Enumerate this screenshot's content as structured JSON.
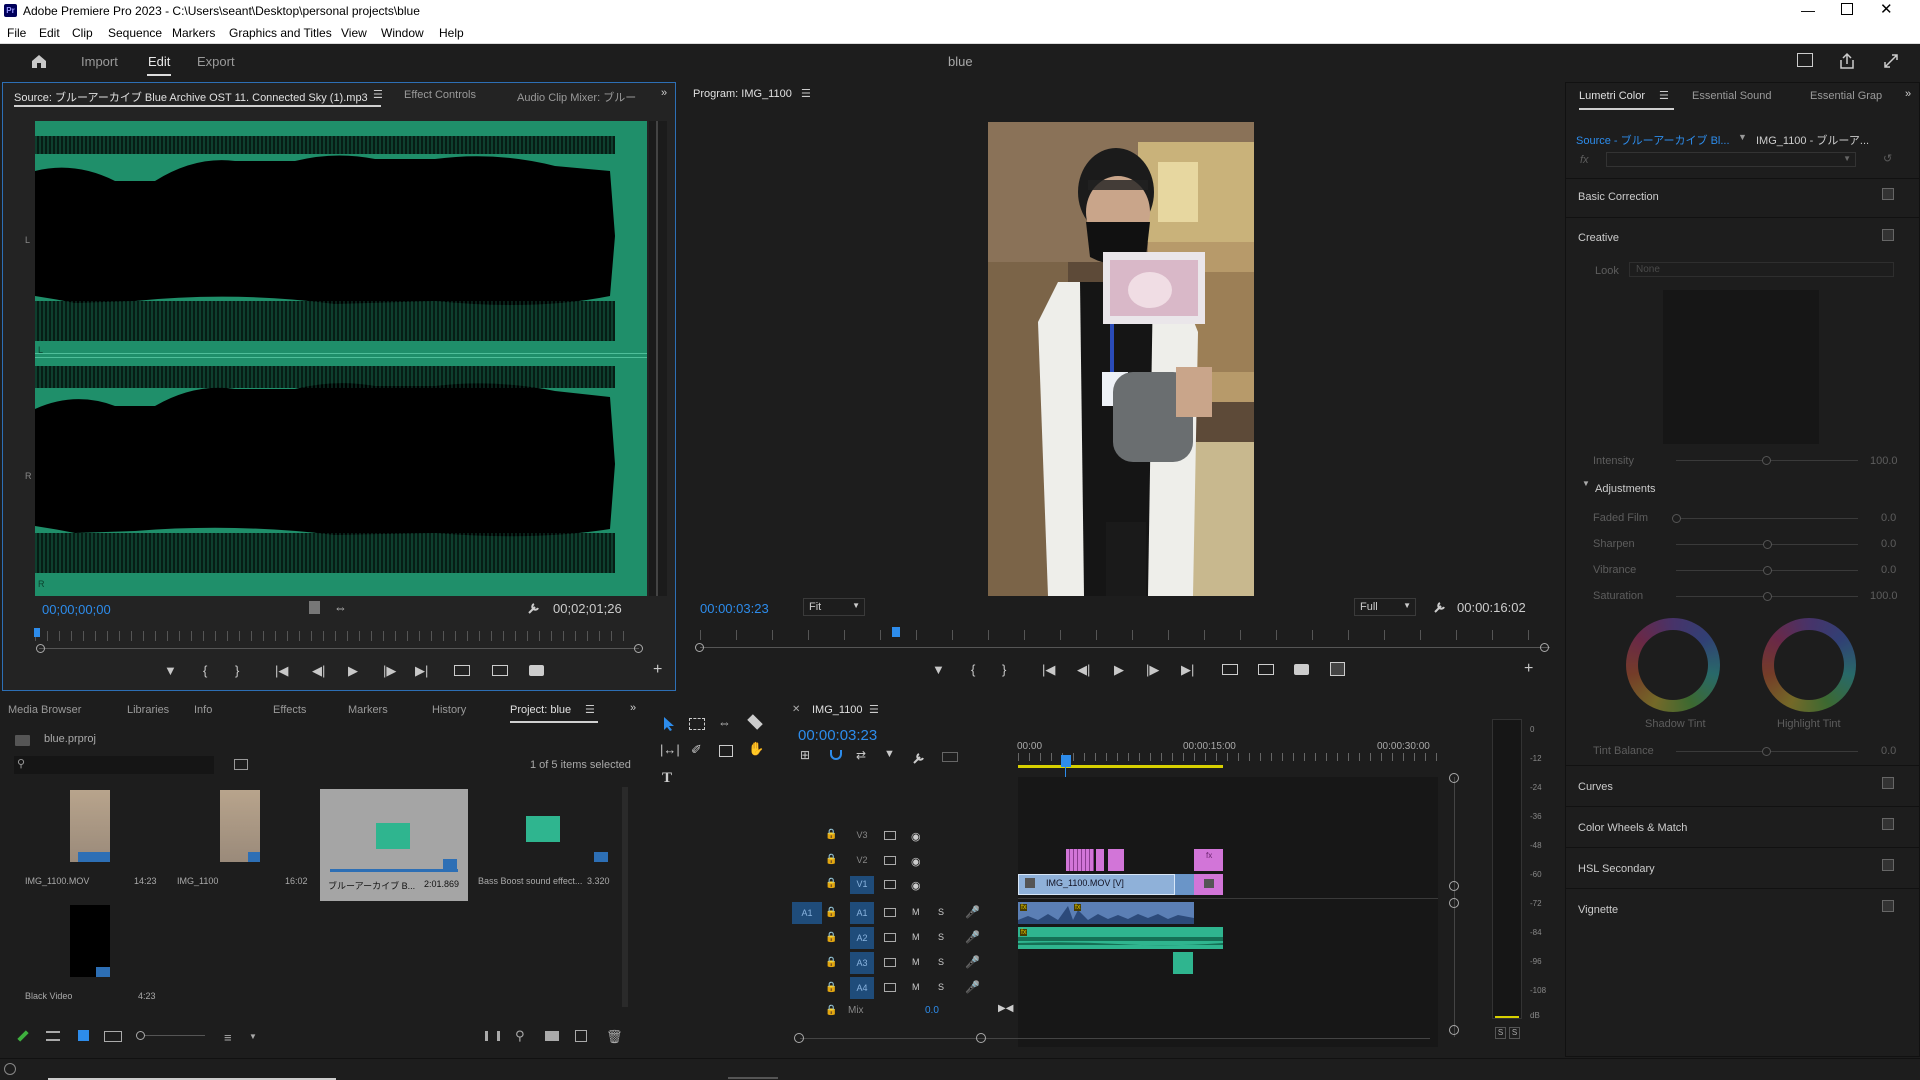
{
  "window": {
    "app_title": "Adobe Premiere Pro 2023 - C:\\Users\\seant\\Desktop\\personal projects\\blue",
    "app_icon": "Pr"
  },
  "menu": [
    "File",
    "Edit",
    "Clip",
    "Sequence",
    "Markers",
    "Graphics and Titles",
    "View",
    "Window",
    "Help"
  ],
  "header": {
    "tabs": [
      "Import",
      "Edit",
      "Export"
    ],
    "active": "Edit",
    "project_name": "blue"
  },
  "source": {
    "tab_label": "Source: ブルーアーカイブ Blue Archive OST 11. Connected Sky (1).mp3",
    "tab2": "Effect Controls",
    "tab3": "Audio Clip Mixer: ブルー",
    "timecode_in": "00;00;00;00",
    "timecode_dur": "00;02;01;26",
    "ch_L": "L",
    "ch_R": "R",
    "ch_l2": "L",
    "ch_r2": "R"
  },
  "program": {
    "tab_label": "Program: IMG_1100",
    "timecode": "00:00:03:23",
    "fit": "Fit",
    "quality": "Full",
    "duration": "00:00:16:02",
    "playhead_fraction": 0.23
  },
  "lumetri": {
    "tab1": "Lumetri Color",
    "tab2": "Essential Sound",
    "tab3": "Essential Grap",
    "source": "Source - ブルーアーカイブ Bl...",
    "clip": "IMG_1100 - ブルーア...",
    "fx": "fx",
    "sections": [
      "Basic Correction",
      "Creative",
      "Curves",
      "Color Wheels & Match",
      "HSL Secondary",
      "Vignette"
    ],
    "look_label": "Look",
    "look_value": "None",
    "intensity": "Intensity",
    "intensity_val": "100.0",
    "adjustments": "Adjustments",
    "sliders": [
      {
        "label": "Faded Film",
        "value": "0.0",
        "pos": 0
      },
      {
        "label": "Sharpen",
        "value": "0.0",
        "pos": 0.5
      },
      {
        "label": "Vibrance",
        "value": "0.0",
        "pos": 0.5
      },
      {
        "label": "Saturation",
        "value": "100.0",
        "pos": 0.5
      }
    ],
    "shadow_tint": "Shadow Tint",
    "highlight_tint": "Highlight Tint",
    "tint_balance": "Tint Balance",
    "tint_balance_val": "0.0"
  },
  "project": {
    "tabs": [
      "Media Browser",
      "Libraries",
      "Info",
      "Effects",
      "Markers",
      "History",
      "Project: blue"
    ],
    "file": "blue.prproj",
    "selection": "1 of 5 items selected",
    "items": [
      {
        "name": "IMG_1100.MOV",
        "dur": "14:23",
        "kind": "video"
      },
      {
        "name": "IMG_1100",
        "dur": "16:02",
        "kind": "video"
      },
      {
        "name": "ブルーアーカイブ B...",
        "dur": "2:01.869",
        "kind": "audio",
        "selected": true
      },
      {
        "name": "Bass Boost sound effect...",
        "dur": "3.320",
        "kind": "audio"
      },
      {
        "name": "Black Video",
        "dur": "4:23",
        "kind": "black"
      }
    ]
  },
  "timeline": {
    "tab": "IMG_1100",
    "timecode": "00:00:03:23",
    "ruler": [
      "00:00",
      "00:00:15:00",
      "00:00:30:00"
    ],
    "tracks_video": [
      "V3",
      "V2",
      "V1"
    ],
    "tracks_audio": [
      "A1",
      "A2",
      "A3",
      "A4"
    ],
    "src_patch": "A1",
    "mix_label": "Mix",
    "mix_value": "0.0",
    "clip_v1": "IMG_1100.MOV [V]",
    "m": "M",
    "s": "S"
  },
  "meter": {
    "db": [
      "0",
      "-12",
      "-24",
      "-36",
      "-48",
      "-60",
      "-72",
      "-84",
      "-96",
      "-108",
      "dB"
    ],
    "solo": [
      "S",
      "S"
    ]
  },
  "colors": {
    "accent": "#2d8ceb",
    "waveform": "#1f8f6a",
    "pink": "#d275d8",
    "audio_clip": "#2fb58f"
  }
}
